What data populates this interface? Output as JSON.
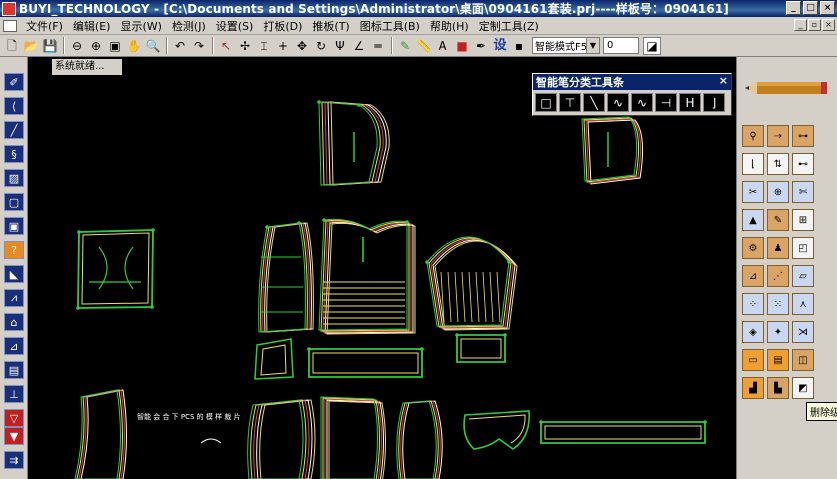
{
  "window": {
    "title": "BUYI_TECHNOLOGY - [C:\\Documents and Settings\\Administrator\\桌面\\0904161套装.prj----样板号：0904161]",
    "controls": [
      "_",
      "□",
      "×"
    ]
  },
  "menu": {
    "items": [
      "文件(F)",
      "编辑(E)",
      "显示(W)",
      "检测(J)",
      "设置(S)",
      "打板(D)",
      "推板(T)",
      "图标工具(B)",
      "帮助(H)",
      "定制工具(Z)"
    ],
    "right_controls": [
      "_",
      "▫",
      "×"
    ]
  },
  "toolbar": {
    "icons": [
      {
        "name": "new-icon",
        "glyph": "🗋"
      },
      {
        "name": "open-icon",
        "glyph": "📂"
      },
      {
        "name": "save-icon",
        "glyph": "💾"
      },
      {
        "name": "zoom-out-icon",
        "glyph": "⊖"
      },
      {
        "name": "zoom-in-icon",
        "glyph": "⊕"
      },
      {
        "name": "zoom-window-icon",
        "glyph": "▣"
      },
      {
        "name": "pan-icon",
        "glyph": "✋"
      },
      {
        "name": "zoom-all-icon",
        "glyph": "🔍"
      },
      {
        "name": "undo-icon",
        "glyph": "↶"
      },
      {
        "name": "redo-icon",
        "glyph": "↷"
      },
      {
        "name": "select-delete-icon",
        "glyph": "↖"
      },
      {
        "name": "point-icon",
        "glyph": "✢"
      },
      {
        "name": "dimension-icon",
        "glyph": "⌶"
      },
      {
        "name": "cross-icon",
        "glyph": "+"
      },
      {
        "name": "move-icon",
        "glyph": "✥"
      },
      {
        "name": "rotate-icon",
        "glyph": "↻"
      },
      {
        "name": "split-icon",
        "glyph": "Ψ"
      },
      {
        "name": "angle-icon",
        "glyph": "∠"
      },
      {
        "name": "parallel-icon",
        "glyph": "═"
      },
      {
        "name": "pencil-green-icon",
        "glyph": "✎"
      },
      {
        "name": "ruler-icon",
        "glyph": "📏"
      },
      {
        "name": "text-style-icon",
        "glyph": "Ꭺ"
      },
      {
        "name": "color-icon",
        "glyph": "■"
      },
      {
        "name": "pen-icon",
        "glyph": "✒"
      },
      {
        "name": "settings-text-icon",
        "glyph": "设"
      },
      {
        "name": "grey-box-icon",
        "glyph": "▪"
      }
    ],
    "mode_combo": "智能模式F5",
    "number_value": "0",
    "end_icon": "straighten-icon"
  },
  "status": "系统就绪...",
  "floating_toolbar": {
    "title": "智能笔分类工具条",
    "close": "×",
    "tools": [
      "□",
      "⊤",
      "╲",
      "∿",
      "∿",
      "⊣",
      "H",
      "⌋"
    ]
  },
  "canvas": {
    "annotation": "智能 会 合 下 PCS 的 模 样 裁 片",
    "tooltip": "删除级"
  },
  "colors": {
    "background": "#000000",
    "outline_green": "#2ecc40",
    "outline_yellow": "#f0e060",
    "outline_red": "#e04040",
    "outline_white": "#ffffff",
    "titlebar": "#0a246a",
    "chrome": "#d4d0c8"
  }
}
